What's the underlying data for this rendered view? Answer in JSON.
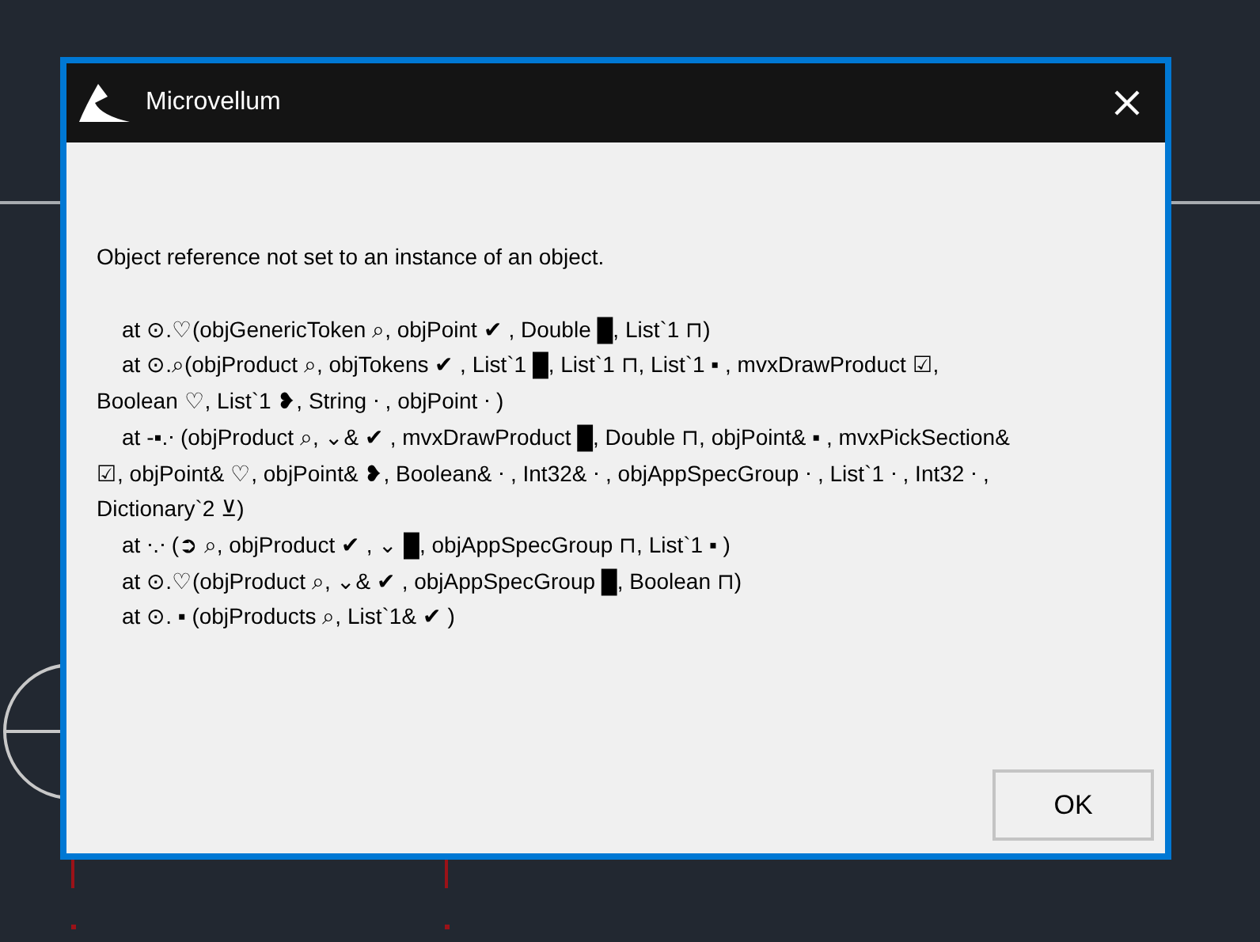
{
  "dialog": {
    "title": "Microvellum",
    "message": "Object reference not set to an instance of an object.",
    "stack_trace": [
      "at ⊙.♡(objGenericToken ⌕, objPoint  ✔ , Double █, List`1 ⊓)",
      "at ⊙.⌕(objProduct ⌕, objTokens  ✔ , List`1 █, List`1 ⊓, List`1  ▪ , mvxDrawProduct ☑, Boolean ♡, List`1 ❥, String ⋅ , objPoint ⋅ )",
      "at -▪.⋅ (objProduct ⌕, ⌄&  ✔ , mvxDrawProduct █, Double ⊓, objPoint& ▪ , mvxPickSection& ☑, objPoint& ♡, objPoint& ❥, Boolean& ⋅ , Int32& ⋅ , objAppSpecGroup ⋅ , List`1 ⋅ , Int32 ⋅ , Dictionary`2 ⊻)",
      "at ⋅.⋅ (➲ ⌕, objProduct  ✔ , ⌄ █, objAppSpecGroup ⊓, List`1  ▪ )",
      "at ⊙.♡(objProduct ⌕, ⌄&  ✔ , objAppSpecGroup █, Boolean ⊓)",
      "at ⊙. ▪ (objProducts ⌕, List`1&  ✔ )"
    ],
    "buttons": [
      "OK"
    ]
  }
}
